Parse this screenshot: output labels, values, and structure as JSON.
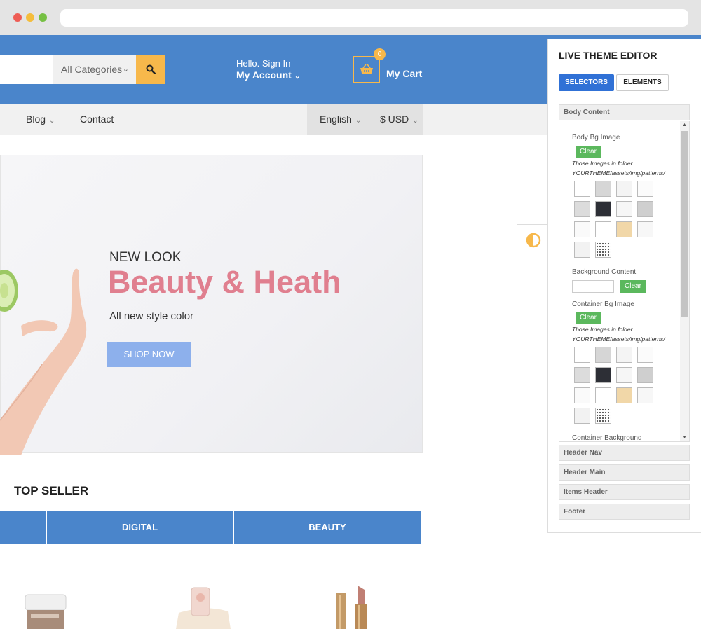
{
  "header": {
    "category_select": "All Categories",
    "account_greeting": "Hello. Sign In",
    "account_label": "My Account",
    "cart_count": "0",
    "cart_label": "My Cart"
  },
  "nav": {
    "blog": "Blog",
    "contact": "Contact",
    "language": "English",
    "currency": "$ USD"
  },
  "hero": {
    "kicker": "NEW LOOK",
    "headline": "Beauty & Heath",
    "subline": "All new style color",
    "cta": "SHOP NOW"
  },
  "top_seller": {
    "title": "TOP SELLER",
    "tabs": [
      "",
      "DIGITAL",
      "BEAUTY"
    ]
  },
  "editor": {
    "title": "LIVE THEME EDITOR",
    "tabs": [
      "SELECTORS",
      "ELEMENTS"
    ],
    "sections": [
      "Body Content",
      "Header Nav",
      "Header Main",
      "Items Header",
      "Footer"
    ],
    "body_bg_label": "Body Bg Image",
    "clear": "Clear",
    "hint_line1": "Those Images in folder",
    "hint_line2": "YOURTHEME/assets/img/patterns/",
    "background_content_label": "Background Content",
    "container_bg_label": "Container Bg Image",
    "container_background_label": "Container Background"
  },
  "colors": {
    "brand_blue": "#4a85cb",
    "accent_orange": "#f7b84b",
    "headline_pink": "#e07f8f",
    "cta_blue": "#8db0ec",
    "clear_green": "#5bb85d"
  }
}
